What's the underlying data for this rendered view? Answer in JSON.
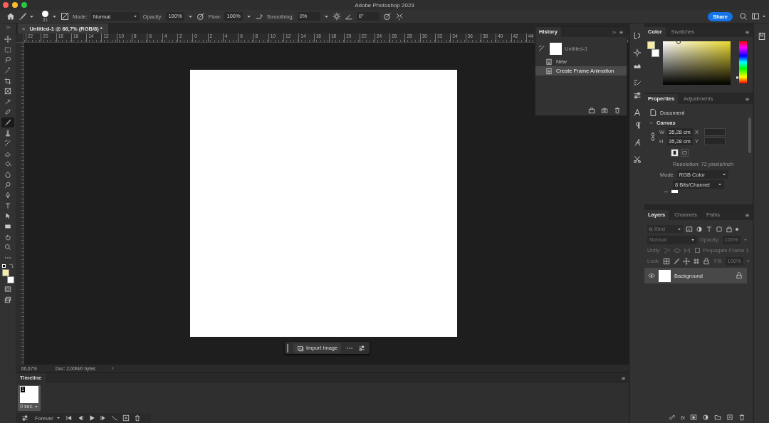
{
  "window": {
    "title": "Adobe Photoshop 2023"
  },
  "options_bar": {
    "brush_size": "31",
    "mode_label": "Mode:",
    "mode": "Normal",
    "opacity_label": "Opacity:",
    "opacity": "100%",
    "flow_label": "Flow:",
    "flow": "100%",
    "smoothing_label": "Smoothing:",
    "smoothing": "0%",
    "angle": "0°",
    "share": "Share"
  },
  "toolbar": {
    "tools": [
      {
        "kind": "move",
        "selected": false
      },
      {
        "kind": "marquee",
        "selected": false
      },
      {
        "kind": "lasso",
        "selected": false
      },
      {
        "kind": "wand",
        "selected": false
      },
      {
        "kind": "crop",
        "selected": false
      },
      {
        "kind": "frame",
        "selected": false
      },
      {
        "kind": "eyedropper",
        "selected": false
      },
      {
        "kind": "bandage",
        "selected": false
      },
      {
        "kind": "brush",
        "selected": true
      },
      {
        "kind": "stamp",
        "selected": false
      },
      {
        "kind": "historybrush",
        "selected": false
      },
      {
        "kind": "eraser",
        "selected": false
      },
      {
        "kind": "bucket",
        "selected": false
      },
      {
        "kind": "drop",
        "selected": false
      },
      {
        "kind": "dodge",
        "selected": false
      },
      {
        "kind": "pen",
        "selected": false
      },
      {
        "kind": "type",
        "selected": false
      },
      {
        "kind": "arrow",
        "selected": false
      },
      {
        "kind": "rect",
        "selected": false
      },
      {
        "kind": "hand",
        "selected": false
      },
      {
        "kind": "zoom",
        "selected": false
      },
      {
        "kind": "more",
        "selected": false
      }
    ]
  },
  "document_tab": {
    "close": "×",
    "title": "Untitled-1 @ 66,7% (RGB/8) *"
  },
  "ruler": {
    "labels": [
      "22",
      "20",
      "18",
      "16",
      "14",
      "12",
      "10",
      "8",
      "6",
      "4",
      "2",
      "0",
      "2",
      "4",
      "6",
      "8",
      "10",
      "12",
      "14",
      "16",
      "18",
      "20",
      "22",
      "24",
      "26",
      "28",
      "30",
      "32",
      "34",
      "36",
      "38",
      "40",
      "42",
      "44"
    ]
  },
  "contextual_bar": {
    "import": "Import Image"
  },
  "status_bar": {
    "zoom": "66,67%",
    "doc": "Doc: 2,00M/0 bytes"
  },
  "history": {
    "title": "History",
    "snapshot": "Untitled-1",
    "states": [
      {
        "label": "New",
        "selected": false
      },
      {
        "label": "Create Frame Animation",
        "selected": true
      }
    ]
  },
  "timeline": {
    "title": "Timeline",
    "frames": [
      {
        "number": "1",
        "delay": "0 sec.",
        "selected": true
      }
    ],
    "loop": "Forever"
  },
  "color_panel": {
    "tabs": [
      {
        "label": "Color",
        "selected": true
      },
      {
        "label": "Swatches",
        "selected": false
      }
    ],
    "hue_slider": {
      "level": 0.14
    }
  },
  "properties": {
    "tabs": [
      {
        "label": "Properties",
        "selected": true
      },
      {
        "label": "Adjustments",
        "selected": false
      }
    ],
    "type": "Document",
    "section": "Canvas",
    "expanded": true,
    "width_label": "W",
    "width": "35,28 cm",
    "height_label": "H",
    "height": "35,28 cm",
    "x_label": "X",
    "y_label": "Y",
    "orientation": [
      {
        "selected": true
      },
      {
        "selected": false
      }
    ],
    "resolution": "Resolution: 72 pixels/inch",
    "mode_label": "Mode",
    "mode": "RGB Color",
    "depth": "8 Bits/Channel"
  },
  "layers": {
    "tabs": [
      {
        "label": "Layers",
        "selected": true
      },
      {
        "label": "Channels",
        "selected": false
      },
      {
        "label": "Paths",
        "selected": false
      }
    ],
    "filter": "Kind",
    "blend": "Normal",
    "opacity_label": "Opacity:",
    "opacity": "100%",
    "unify_label": "Unify:",
    "propagate": "Propagate Frame 1",
    "propagate_checked": false,
    "lock_label": "Lock:",
    "fill_label": "Fill:",
    "fill": "100%",
    "items": [
      {
        "name": "Background",
        "selected": true,
        "visible": true,
        "locked": true
      }
    ],
    "effects": "fx"
  }
}
